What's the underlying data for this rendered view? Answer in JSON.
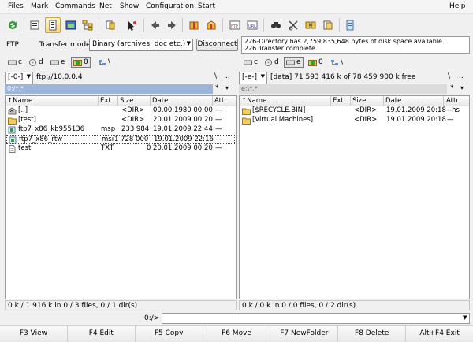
{
  "menu": [
    "Files",
    "Mark",
    "Commands",
    "Net",
    "Show",
    "Configuration",
    "Start",
    "Help"
  ],
  "ftp_bar": {
    "label": "FTP",
    "transfer_mode_label": "Transfer mode",
    "transfer_mode_value": "Binary (archives, doc etc.)",
    "disconnect_label": "Disconnect",
    "log_lines": [
      "226-Directory has 2,759,835,648 bytes of disk space available.",
      "226 Transfer complete."
    ]
  },
  "left_drives": [
    {
      "letter": "c",
      "selected": false
    },
    {
      "letter": "d",
      "selected": false
    },
    {
      "letter": "e",
      "selected": false
    },
    {
      "letter": "0",
      "selected": true
    },
    {
      "letter": "\\",
      "selected": false
    }
  ],
  "right_drives": [
    {
      "letter": "c",
      "selected": false
    },
    {
      "letter": "d",
      "selected": false
    },
    {
      "letter": "e",
      "selected": true
    },
    {
      "letter": "0",
      "selected": false
    },
    {
      "letter": "\\",
      "selected": false
    }
  ],
  "left_panel": {
    "drive_combo": "[-0-]",
    "address": "ftp://10.0.0.4",
    "current_path": "0:/*.*",
    "nav_back": "\\",
    "nav_up": "..",
    "nav_star": "*",
    "nav_sort": "▾",
    "columns": [
      "↑Name",
      "Ext",
      "Size",
      "Date",
      "Attr"
    ],
    "files": [
      {
        "name": "[..]",
        "ext": "",
        "size": "<DIR>",
        "date": "00.00.1980 00:00",
        "attr": "—",
        "icon": "up-dir",
        "cursor": false
      },
      {
        "name": "[test]",
        "ext": "",
        "size": "<DIR>",
        "date": "20.01.2009 00:20",
        "attr": "—",
        "icon": "folder",
        "cursor": false
      },
      {
        "name": "ftp7_x86_kb955136",
        "ext": "msp",
        "size": "233 984",
        "date": "19.01.2009 22:44",
        "attr": "—",
        "icon": "package",
        "cursor": false
      },
      {
        "name": "ftp7_x86_rtw",
        "ext": "msi",
        "size": "1 728 000",
        "date": "19.01.2009 22:16",
        "attr": "—",
        "icon": "package",
        "cursor": true
      },
      {
        "name": "test",
        "ext": "TXT",
        "size": "0",
        "date": "20.01.2009 00:20",
        "attr": "—",
        "icon": "file",
        "cursor": false
      }
    ],
    "status": "0 k / 1 916 k in 0 / 3 files, 0 / 1 dir(s)"
  },
  "right_panel": {
    "drive_combo": "[-e-]",
    "volume_info": "[data]  71 593 416 k of 78 459 900 k free",
    "current_path": "e:\\*.*",
    "nav_back": "\\",
    "nav_up": "..",
    "nav_star": "*",
    "nav_sort": "▾",
    "columns": [
      "↑Name",
      "Ext",
      "Size",
      "Date",
      "Attr"
    ],
    "files": [
      {
        "name": "[$RECYCLE.BIN]",
        "ext": "",
        "size": "<DIR>",
        "date": "19.01.2009 20:18",
        "attr": "--hs",
        "icon": "folder",
        "cursor": false
      },
      {
        "name": "[Virtual Machines]",
        "ext": "",
        "size": "<DIR>",
        "date": "19.01.2009 20:18",
        "attr": "—",
        "icon": "folder",
        "cursor": false
      }
    ],
    "status": "0 k / 0 k in 0 / 0 files, 0 / 2 dir(s)"
  },
  "command_line": {
    "prompt": "0:/>",
    "value": ""
  },
  "function_keys": [
    "F3 View",
    "F4 Edit",
    "F5 Copy",
    "F6 Move",
    "F7 NewFolder",
    "F8 Delete",
    "Alt+F4 Exit"
  ]
}
